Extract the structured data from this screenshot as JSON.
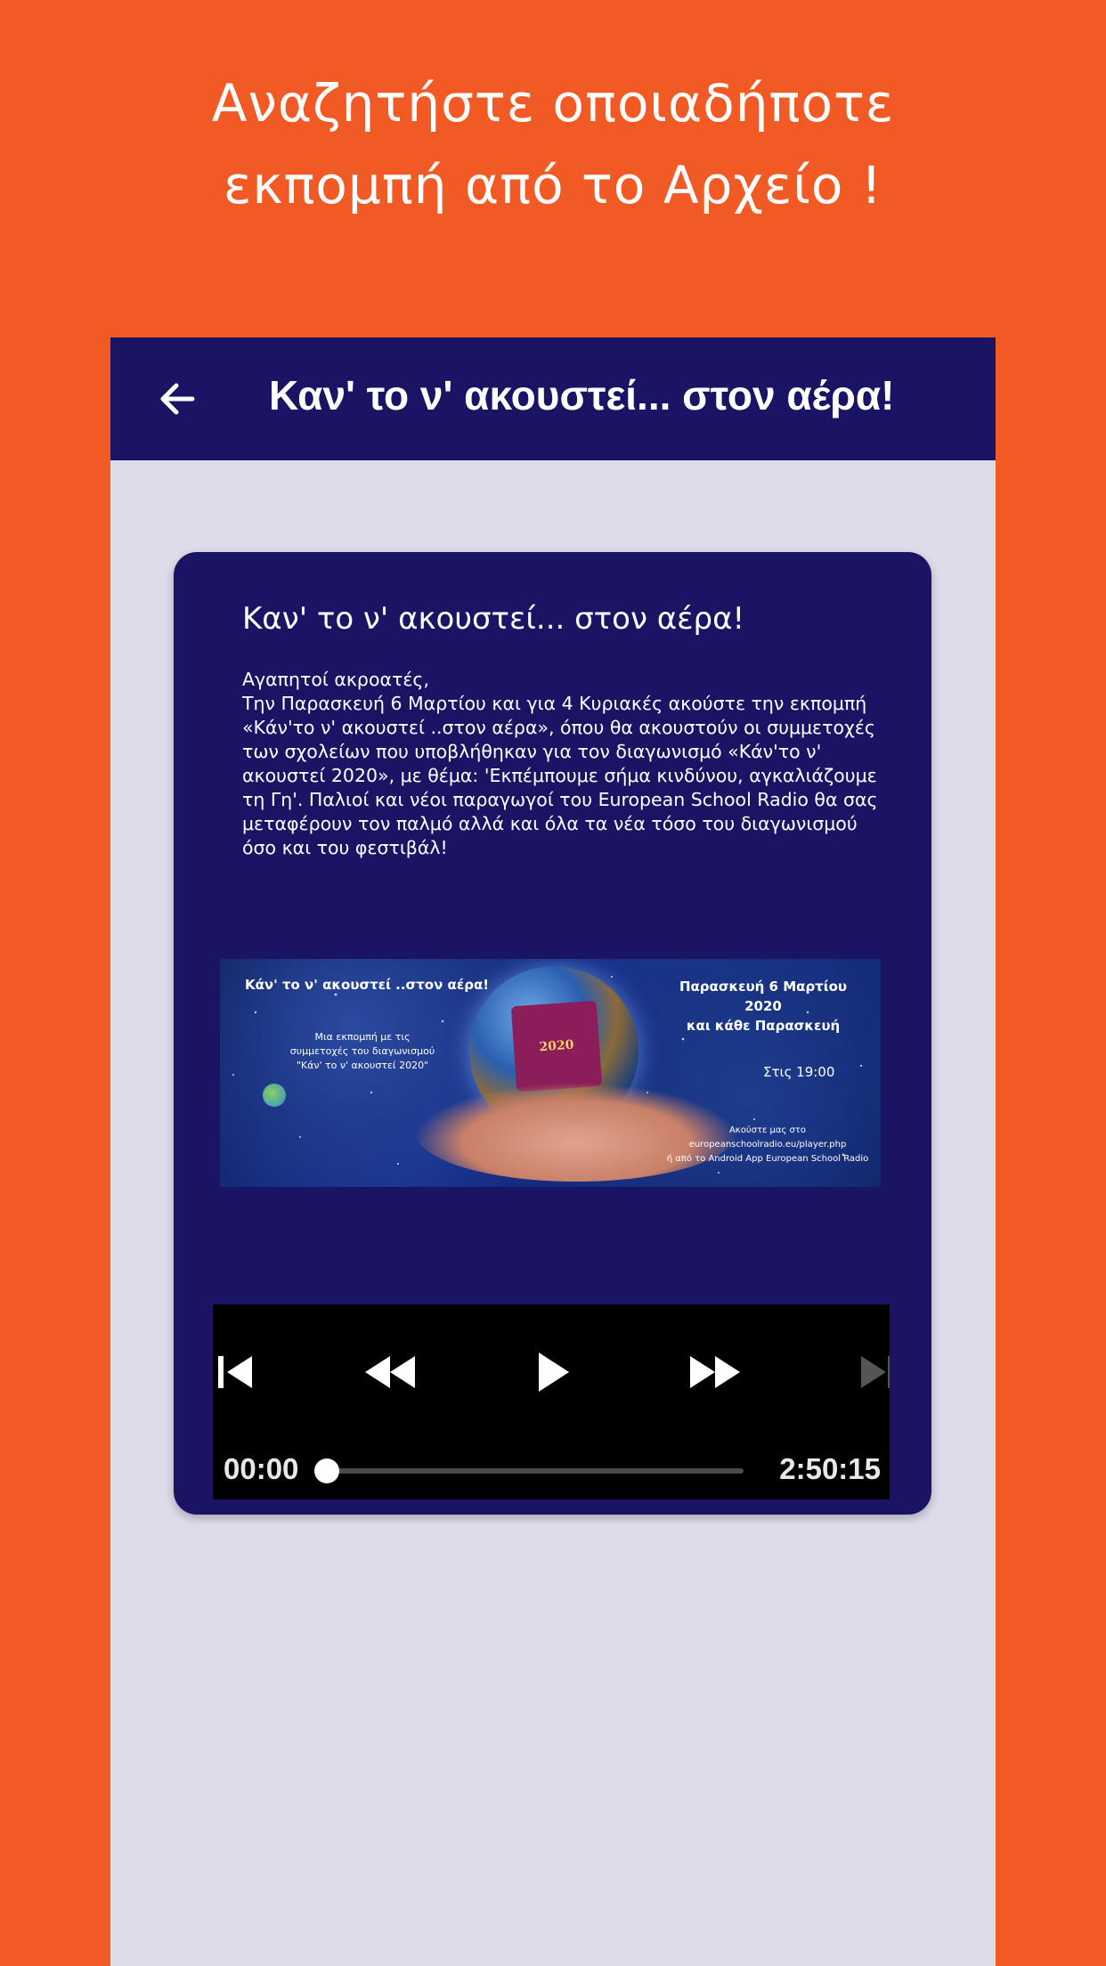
{
  "promo": {
    "line1": "Αναζητήστε οποιαδήποτε",
    "line2": "εκπομπή από το Αρχείο !"
  },
  "colors": {
    "background": "#F15A24",
    "appbar": "#1B1464",
    "content_bg": "#DEDCEA",
    "card": "#1B1464"
  },
  "appbar": {
    "back_icon": "arrow-left-icon",
    "title": "Καν' το ν' ακουστεί... στον αέρα!"
  },
  "card": {
    "title": "Καν' το ν' ακουστεί... στον αέρα!",
    "body": [
      "Αγαπητοί ακροατές,",
      "Την Παρασκευή 6 Μαρτίου και για 4 Κυριακές ακούστε την εκπομπή «Κάν'το ν' ακουστεί ..στον αέρα», όπου θα ακουστούν οι συμμετοχές των σχολείων που υποβλήθηκαν για τον διαγωνισμό «Κάν'το ν' ακουστεί 2020», με θέμα: 'Εκπέμπουμε σήμα κινδύνου, αγκαλιάζουμε τη Γη'. Παλιοί και νέοι παραγωγοί του European School Radio θα σας μεταφέρουν τον παλμό αλλά και όλα τα νέα τόσο του διαγωνισμού όσο και του φεστιβάλ!"
    ],
    "poster": {
      "left_title": "Κάν' το ν' ακουστεί ..στον αέρα!",
      "left_sub1": "Μια εκπομπή με τις",
      "left_sub2": "συμμετοχές του διαγωνισμού",
      "left_sub3": "\"Κάν' το ν' ακουστεί 2020\"",
      "right_date1": "Παρασκευή 6 Μαρτίου 2020",
      "right_date2": "και κάθε Παρασκευή",
      "right_time": "Στις 19:00",
      "right_listen1": "Ακούστε μας στο",
      "right_listen2": "europeanschoolradio.eu/player.php",
      "right_listen3": "ή από το Android App European School Radio",
      "logo_text": "2020"
    }
  },
  "player": {
    "controls": [
      {
        "name": "skip-previous-icon",
        "disabled": false
      },
      {
        "name": "rewind-icon",
        "disabled": false
      },
      {
        "name": "play-icon",
        "disabled": false
      },
      {
        "name": "fast-forward-icon",
        "disabled": false
      },
      {
        "name": "skip-next-icon",
        "disabled": true
      }
    ],
    "position": "00:00",
    "duration": "2:50:15",
    "progress": 0.0
  }
}
